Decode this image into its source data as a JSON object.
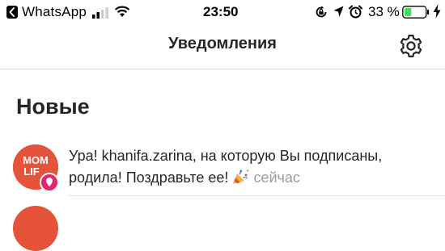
{
  "status_bar": {
    "back_app": "WhatsApp",
    "time": "23:50",
    "battery_percent": "33 %",
    "battery_level": 0.33,
    "icons": [
      "back-arrow-icon",
      "signal-icon",
      "wifi-icon",
      "rotation-lock-icon",
      "location-icon",
      "alarm-icon",
      "battery-icon",
      "charging-bolt-icon"
    ],
    "battery_color": "#4cd964"
  },
  "header": {
    "title": "Уведомления",
    "settings_icon": "gear-icon"
  },
  "section": {
    "title": "Новые"
  },
  "notifications": [
    {
      "avatar_text_line1": "MOM",
      "avatar_text_line2": "LIF",
      "avatar_color": "#e5533a",
      "badge_color": "#e6246c",
      "text": "Ура! khanifa.zarina, на которую Вы подписаны, родила! Поздравьте ее!",
      "emoji_icon": "party-popper-icon",
      "time": "сейчас"
    }
  ]
}
